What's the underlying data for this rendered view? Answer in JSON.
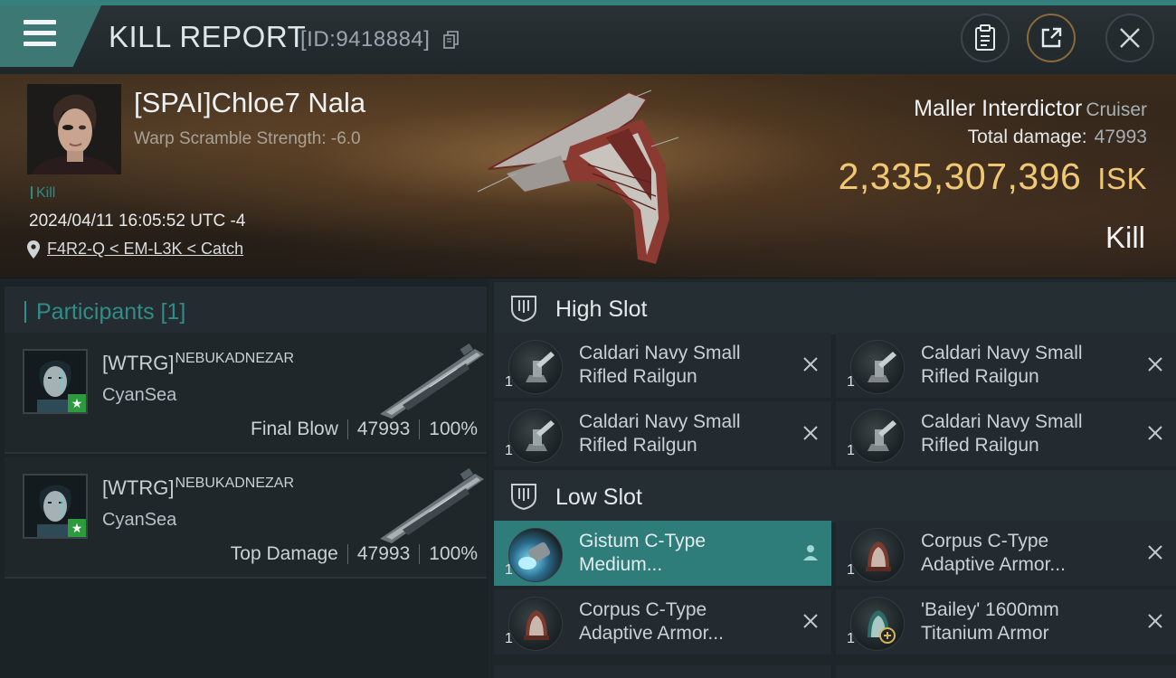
{
  "header": {
    "title": "KILL REPORT",
    "kill_id": "[ID:9418884]",
    "icons": [
      "menu-icon",
      "copy-icon",
      "clipboard-icon",
      "share-icon",
      "close-icon"
    ]
  },
  "victim": {
    "name": "[SPAI]Chloe7 Nala",
    "warp_scramble": "Warp Scramble Strength: -6.0",
    "kill_tag": "Kill",
    "datetime": "2024/04/11 16:05:52 UTC -4",
    "location": "F4R2-Q < EM-L3K < Catch",
    "ship_name": "Maller Interdictor",
    "ship_class": "Cruiser",
    "total_damage_label": "Total damage:",
    "total_damage_value": "47993",
    "isk_value": "2,335,307,396",
    "isk_unit": "ISK",
    "result": "Kill"
  },
  "participants": {
    "header": "Participants [1]",
    "rows": [
      {
        "corp": "[WTRG]",
        "name": "NEBUKADNEZAR",
        "alliance": "CyanSea",
        "label": "Final Blow",
        "damage": "47993",
        "percent": "100%"
      },
      {
        "corp": "[WTRG]",
        "name": "NEBUKADNEZAR",
        "alliance": "CyanSea",
        "label": "Top Damage",
        "damage": "47993",
        "percent": "100%"
      }
    ]
  },
  "slots": {
    "high": {
      "title": "High Slot",
      "modules": [
        {
          "qty": "1",
          "name_line1": "Caldari Navy Small",
          "name_line2": "Rifled Railgun"
        },
        {
          "qty": "1",
          "name_line1": "Caldari Navy Small",
          "name_line2": "Rifled Railgun"
        },
        {
          "qty": "1",
          "name_line1": "Caldari Navy Small",
          "name_line2": "Rifled Railgun"
        },
        {
          "qty": "1",
          "name_line1": "Caldari Navy Small",
          "name_line2": "Rifled Railgun"
        }
      ]
    },
    "low": {
      "title": "Low Slot",
      "modules": [
        {
          "qty": "1",
          "name_line1": "Gistum C-Type",
          "name_line2": "Medium..."
        },
        {
          "qty": "1",
          "name_line1": "Corpus C-Type",
          "name_line2": "Adaptive Armor..."
        },
        {
          "qty": "1",
          "name_line1": "Corpus C-Type",
          "name_line2": "Adaptive Armor..."
        },
        {
          "qty": "1",
          "name_line1": "'Bailey' 1600mm",
          "name_line2": "Titanium Armor"
        }
      ]
    }
  },
  "colors": {
    "accent_teal": "#35807d",
    "isk_gold": "#f0c874",
    "selected_module": "#2f7d7a",
    "dropped_badge": "#2c9a3d"
  }
}
